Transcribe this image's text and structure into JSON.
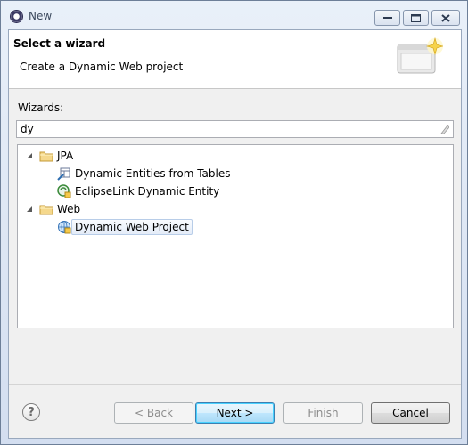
{
  "window": {
    "title": "New"
  },
  "header": {
    "title": "Select a wizard",
    "description": "Create a Dynamic Web project"
  },
  "wizards": {
    "label": "Wizards:",
    "filter_value": "dy",
    "tree": [
      {
        "label": "JPA",
        "icon": "folder-icon",
        "expanded": true,
        "children": [
          {
            "label": "Dynamic Entities from Tables",
            "icon": "entities-from-tables-icon"
          },
          {
            "label": "EclipseLink Dynamic Entity",
            "icon": "eclipselink-entity-icon"
          }
        ]
      },
      {
        "label": "Web",
        "icon": "folder-icon",
        "expanded": true,
        "children": [
          {
            "label": "Dynamic Web Project",
            "icon": "web-project-icon",
            "selected": true
          }
        ]
      }
    ]
  },
  "buttons": {
    "help": "?",
    "back": "< Back",
    "next": "Next >",
    "finish": "Finish",
    "cancel": "Cancel"
  },
  "colors": {
    "accent": "#3c7fb1",
    "folder": "#e8b84a"
  }
}
